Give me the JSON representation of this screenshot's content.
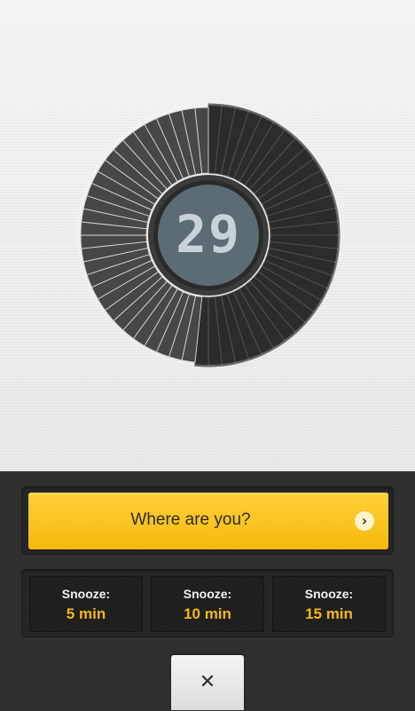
{
  "timer": {
    "digits": "29",
    "filled_fraction": 0.52
  },
  "primary_action": {
    "label": "Where are you?",
    "chevron_icon": "chevron-right-icon"
  },
  "snooze": [
    {
      "title": "Snooze:",
      "value": "5 min"
    },
    {
      "title": "Snooze:",
      "value": "10 min"
    },
    {
      "title": "Snooze:",
      "value": "15 min"
    }
  ],
  "dismiss": {
    "icon": "close-icon"
  },
  "colors": {
    "accent": "#f6b90b",
    "snooze_value": "#f5b817",
    "panel": "#2f2f2f",
    "lcd_background": "#5b6c74",
    "lcd_digits": "#c9d3d7"
  }
}
